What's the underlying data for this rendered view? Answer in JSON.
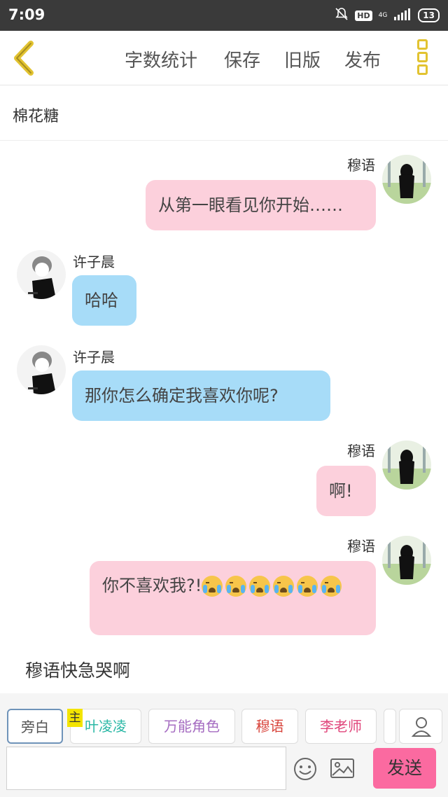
{
  "status_bar": {
    "time": "7:09",
    "hd_label": "HD",
    "network_label": "4G",
    "battery": "13",
    "icons": [
      "bell-off-icon",
      "hd-icon",
      "signal-icon",
      "battery-icon"
    ]
  },
  "toolbar": {
    "back_icon": "chevron-left-icon",
    "items": [
      "字数统计",
      "保存",
      "旧版",
      "发布"
    ],
    "more_icon": "more-vertical-icon",
    "accent_color": "#e2c331"
  },
  "story_title": "棉花糖",
  "messages": [
    {
      "side": "right",
      "sender": "穆语",
      "text": "从第一眼看见你开始……",
      "emoji_count": 0
    },
    {
      "side": "left",
      "sender": "许子晨",
      "text": "哈哈",
      "emoji_count": 0
    },
    {
      "side": "left",
      "sender": "许子晨",
      "text": "那你怎么确定我喜欢你呢?",
      "emoji_count": 0
    },
    {
      "side": "right",
      "sender": "穆语",
      "text": "啊!",
      "emoji_count": 0
    },
    {
      "side": "right",
      "sender": "穆语",
      "text": "你不喜欢我?!",
      "emoji_count": 6,
      "emoji": "loudly-crying-face-icon"
    }
  ],
  "narration": "穆语快急哭啊",
  "roles": {
    "main_tag": "主",
    "items": [
      {
        "label": "旁白",
        "color": "#555555"
      },
      {
        "label": "叶凌凌",
        "color": "#2bb8a6"
      },
      {
        "label": "万能角色",
        "color": "#a56cc1"
      },
      {
        "label": "穆语",
        "color": "#d8443b"
      },
      {
        "label": "李老师",
        "color": "#e0457b"
      }
    ],
    "profile_icon": "user-icon"
  },
  "composer": {
    "input_value": "",
    "emoji_icon": "smiley-icon",
    "image_icon": "image-icon",
    "send_label": "发送",
    "send_color": "#fb6aa0"
  },
  "colors": {
    "bubble_pink": "#fcd0dc",
    "bubble_blue": "#a7dcf8"
  }
}
